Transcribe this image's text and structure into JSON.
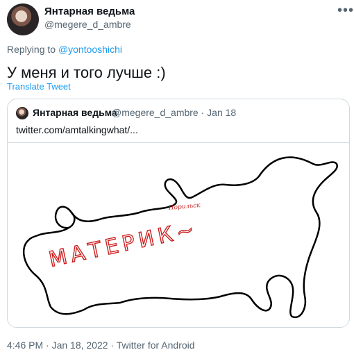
{
  "author": {
    "name": "Янтарная ведьма",
    "handle": "@megere_d_ambre"
  },
  "more_label": "•••",
  "reply": {
    "prefix": "Replying to",
    "to": "@yontooshichi"
  },
  "tweet": {
    "text": "У меня и того лучше :)",
    "translate_label": "Translate Tweet"
  },
  "quote": {
    "name": "Янтарная ведьма",
    "meta": "@megere_d_ambre · Jan 18",
    "link": "twitter.com/amtalkingwhat/...",
    "image": {
      "word_main": "МАТЕРИК~",
      "word_small": "Норильск",
      "outline_color": "#000000",
      "ink_color": "#cc1f1f"
    }
  },
  "footer": {
    "text": "4:46 PM · Jan 18, 2022 · Twitter for Android"
  }
}
